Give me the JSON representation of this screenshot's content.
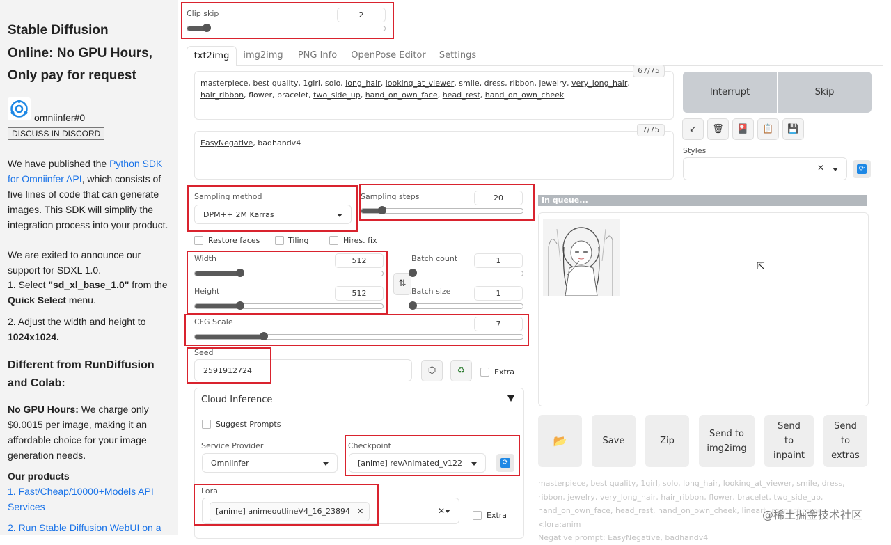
{
  "sidebar": {
    "title_lines": [
      "Stable Diffusion",
      "Online: No GPU Hours,",
      "Only pay for request"
    ],
    "user_name": "omniinfer#0",
    "discord_button": "DISCUSS IN DISCORD",
    "para1": {
      "pre": "We have published the ",
      "link": "Python SDK for Omniinfer API",
      "post": ", which consists of five lines of code that can generate images. This SDK will simplify the integration process into your product."
    },
    "para2": {
      "intro": "We are exited to announce our support for SDXL 1.0.",
      "step1_pre": "1. Select ",
      "step1_bold": "\"sd_xl_base_1.0\"",
      "step1_mid": " from the ",
      "step1_bold2": "Quick Select",
      "step1_post": " menu.",
      "step2_pre": "2. Adjust the width and height to ",
      "step2_bold": "1024x1024."
    },
    "section_title": "Different from RunDiffusion and Colab:",
    "para3": {
      "bold": "No GPU Hours:",
      "text": " We charge only $0.0015 per image, making it an affordable choice for your image generation needs."
    },
    "products_title": "Our products",
    "product_links": [
      "1. Fast/Cheap/10000+Models API Services",
      "2. Run Stable Diffusion WebUI on a"
    ]
  },
  "clip_skip": {
    "label": "Clip skip",
    "value": "2",
    "level": 0.1
  },
  "tabs": [
    "txt2img",
    "img2img",
    "PNG Info",
    "OpenPose Editor",
    "Settings"
  ],
  "prompt": {
    "counter": "67/75",
    "tokens": [
      {
        "t": "masterpiece, best quality, 1girl, solo, ",
        "u": false
      },
      {
        "t": "long_hair",
        "u": true
      },
      {
        "t": ", ",
        "u": false
      },
      {
        "t": "looking_at_viewer",
        "u": true
      },
      {
        "t": ", smile, dress, ribbon, jewelry, ",
        "u": false
      },
      {
        "t": "very_long_hair",
        "u": true
      },
      {
        "t": ", ",
        "u": false
      },
      {
        "t": "hair_ribbon",
        "u": true
      },
      {
        "t": ", flower, bracelet, ",
        "u": false
      },
      {
        "t": "two_side_up",
        "u": true
      },
      {
        "t": ", ",
        "u": false
      },
      {
        "t": "hand_on_own_face",
        "u": true
      },
      {
        "t": ", ",
        "u": false
      },
      {
        "t": "head_rest",
        "u": true
      },
      {
        "t": ", ",
        "u": false
      },
      {
        "t": "hand_on_own_cheek",
        "u": true
      }
    ]
  },
  "negative_prompt": {
    "counter": "7/75",
    "tokens": [
      {
        "t": "EasyNegative",
        "u": true
      },
      {
        "t": ", badhandv4",
        "u": false
      }
    ]
  },
  "buttons": {
    "interrupt": "Interrupt",
    "skip": "Skip"
  },
  "tool_icons": [
    "↙",
    "🗑",
    "🎴",
    "📋",
    "💾"
  ],
  "styles_label": "Styles",
  "sampling": {
    "method_label": "Sampling method",
    "method_value": "DPM++ 2M Karras",
    "steps_label": "Sampling steps",
    "steps_value": "20",
    "steps_level": 0.13
  },
  "checkboxes": {
    "restore_faces": "Restore faces",
    "tiling": "Tiling",
    "hires_fix": "Hires. fix"
  },
  "width": {
    "label": "Width",
    "value": "512",
    "level": 0.24
  },
  "height": {
    "label": "Height",
    "value": "512",
    "level": 0.24
  },
  "batch_count": {
    "label": "Batch count",
    "value": "1",
    "level": 0.0
  },
  "batch_size": {
    "label": "Batch size",
    "value": "1",
    "level": 0.0
  },
  "swap_icon": "⇅",
  "cfg": {
    "label": "CFG Scale",
    "value": "7",
    "level": 0.21
  },
  "seed": {
    "label": "Seed",
    "value": "2591912724",
    "extra_label": "Extra"
  },
  "cloud": {
    "title": "Cloud Inference",
    "suggest_prompts": "Suggest Prompts",
    "provider_label": "Service Provider",
    "provider_value": "Omniinfer",
    "checkpoint_label": "Checkpoint",
    "checkpoint_value": "[anime] revAnimated_v122",
    "lora_label": "Lora",
    "lora_value": "[anime] animeoutlineV4_16_23894",
    "lora_extra": "Extra"
  },
  "output": {
    "status": "In queue...",
    "actions": [
      "Save",
      "Zip",
      "Send to img2img",
      "Send to inpaint",
      "Send to extras"
    ],
    "info_text": "masterpiece, best quality, 1girl, solo, long_hair, looking_at_viewer, smile, dress, ribbon, jewelry, very_long_hair, hair_ribbon, flower, bracelet, two_side_up, hand_on_own_face, head_rest, hand_on_own_cheek, lineart, monochrome, <lora:anim",
    "info_neg": "Negative prompt: EasyNegative, badhandv4"
  },
  "watermark": "@稀土掘金技术社区",
  "colors": {
    "accent": "#1e88e5",
    "highlight": "#d9232e",
    "link": "#1a73e8"
  }
}
